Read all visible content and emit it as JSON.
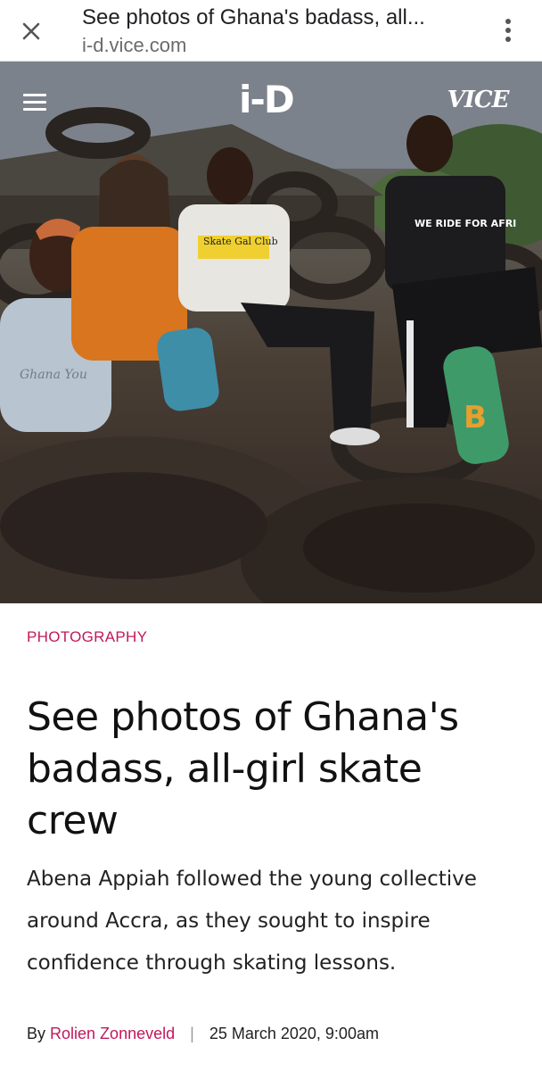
{
  "browser": {
    "title": "See photos of Ghana's badass, all...",
    "url": "i-d.vice.com",
    "close_icon": "close-icon",
    "menu_icon": "more-vert-icon"
  },
  "site": {
    "logo": "i-D",
    "partner_logo": "VICE",
    "menu_icon": "hamburger-icon"
  },
  "hero": {
    "shirt_text_1": "Skate Gal Club",
    "shirt_text_2": "WE RIDE FOR AFRI",
    "shirt_text_3": "Ghana You",
    "board_text": "B"
  },
  "article": {
    "category": "PHOTOGRAPHY",
    "headline": "See photos of Ghana's badass, all-girl skate crew",
    "dek": "Abena Appiah followed the young collective around Accra, as they sought to inspire confidence through skating lessons.",
    "byline_prefix": "By",
    "author": "Rolien Zonneveld",
    "separator": "|",
    "date": "25 March 2020, 9:00am"
  },
  "colors": {
    "accent": "#c2185b",
    "text": "#111111"
  }
}
